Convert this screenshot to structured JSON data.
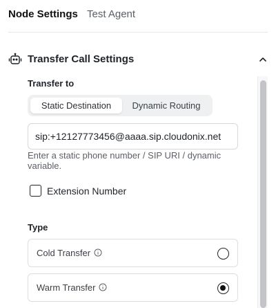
{
  "tabs": [
    {
      "label": "Node Settings",
      "active": true
    },
    {
      "label": "Test Agent",
      "active": false
    }
  ],
  "section": {
    "title": "Transfer Call Settings",
    "icon": "robot-icon",
    "toggle_icon": "chevron-up-icon"
  },
  "transfer_to": {
    "label": "Transfer to",
    "segments": [
      "Static Destination",
      "Dynamic Routing"
    ],
    "selected_segment": "Static Destination",
    "input_value": "sip:+12127773456@aaaa.sip.cloudonix.net",
    "helper": "Enter a static phone number / SIP URI / dynamic variable."
  },
  "extension": {
    "label": "Extension Number",
    "checked": false
  },
  "type": {
    "label": "Type",
    "options": [
      {
        "label": "Cold Transfer",
        "selected": false
      },
      {
        "label": "Warm Transfer",
        "selected": true
      }
    ]
  },
  "colors": {
    "text_primary": "#1f2329",
    "text_secondary": "#5b6068",
    "segment_bg": "#eff0f2",
    "border": "#dcdee2",
    "scroll_thumb": "#c2c4c8"
  }
}
